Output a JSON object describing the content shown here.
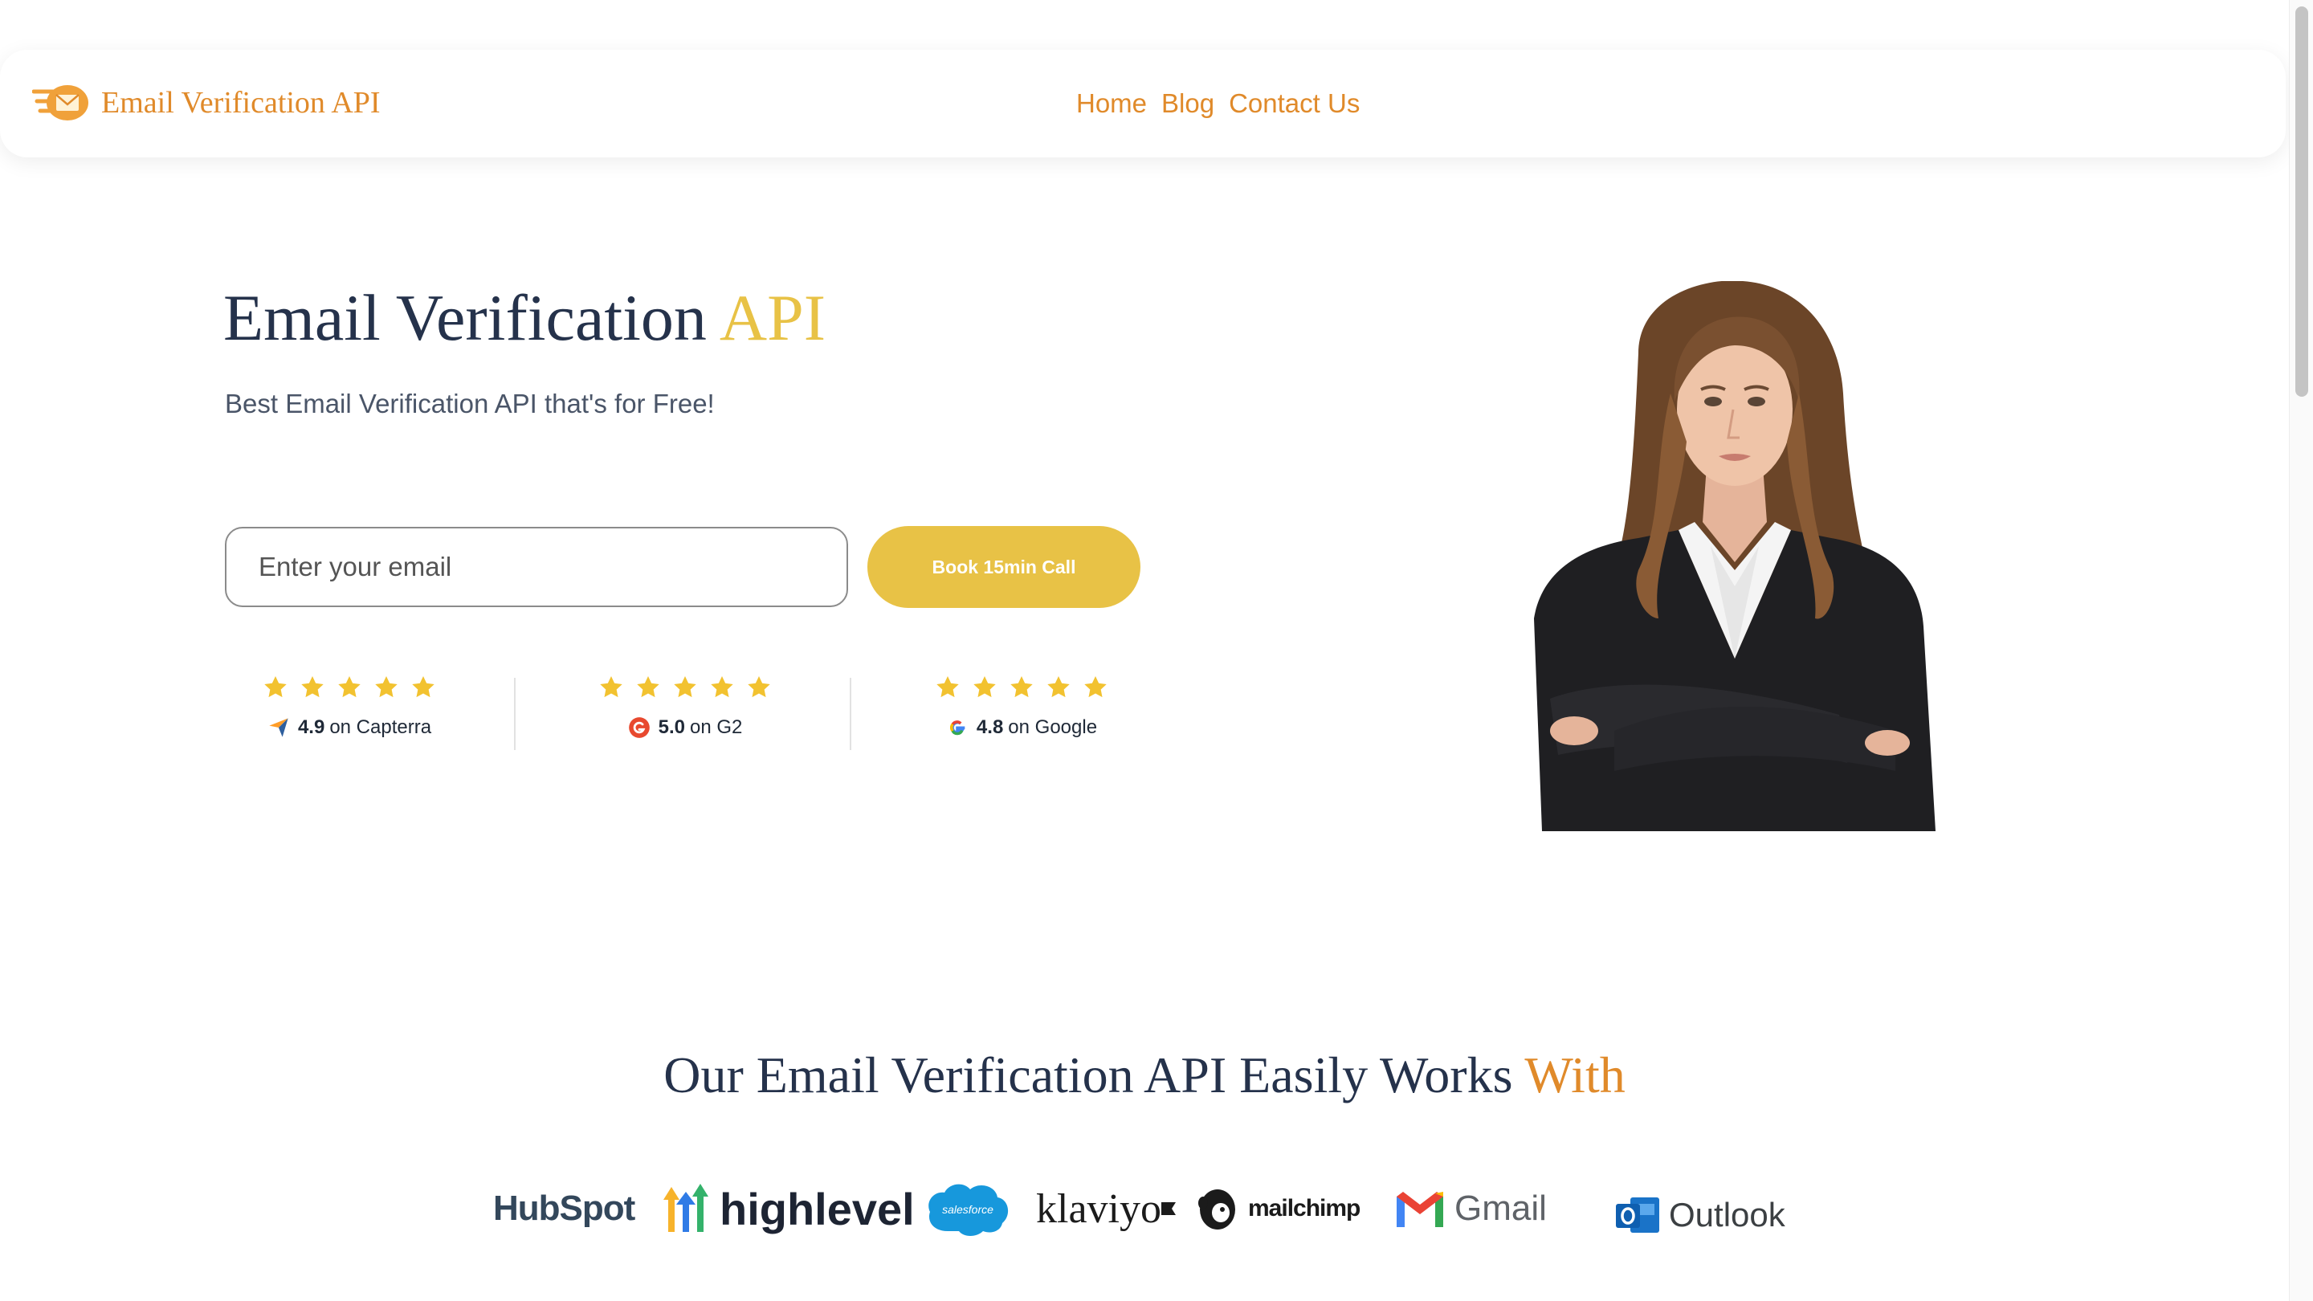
{
  "nav": {
    "brand": "Email Verification API",
    "links": [
      "Home",
      "Blog",
      "Contact Us"
    ]
  },
  "hero": {
    "title_main": "Email Verification",
    "title_accent": "API",
    "subtitle": "Best Email Verification API that's for Free!",
    "email_placeholder": "Enter your email",
    "cta_label": "Book 15min Call"
  },
  "ratings": [
    {
      "score": "4.9",
      "site": "on Capterra",
      "stars": 5,
      "icon": "capterra-icon"
    },
    {
      "score": "5.0",
      "site": "on G2",
      "stars": 5,
      "icon": "g2-icon"
    },
    {
      "score": "4.8",
      "site": "on Google",
      "stars": 5,
      "icon": "google-icon"
    }
  ],
  "integrations": {
    "title_main": "Our Email Verification API Easily Works",
    "title_accent": "With",
    "partners": [
      "HubSpot",
      "highlevel",
      "salesforce",
      "klaviyo",
      "mailchimp",
      "Gmail",
      "Outlook"
    ]
  },
  "colors": {
    "brand_orange": "#e08a2a",
    "accent_yellow": "#e8c246",
    "heading_navy": "#25324b",
    "star_yellow": "#f2c230"
  }
}
